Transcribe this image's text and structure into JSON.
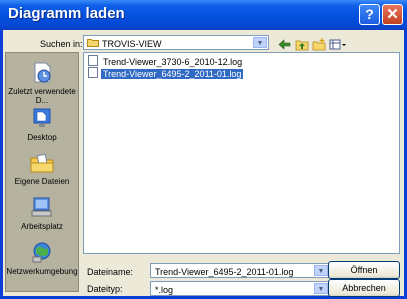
{
  "dialog": {
    "title": "Diagramm laden"
  },
  "titlebar": {
    "help_glyph": "?",
    "close_glyph": "✕"
  },
  "lookin": {
    "label": "Suchen in:",
    "value": "TROVIS-VIEW"
  },
  "toolbar": {
    "icons": [
      "back-arrow-icon",
      "up-folder-icon",
      "new-folder-icon",
      "view-menu-icon"
    ]
  },
  "places": [
    {
      "label": "Zuletzt verwendete D...",
      "icon": "recent-documents-icon"
    },
    {
      "label": "Desktop",
      "icon": "desktop-icon"
    },
    {
      "label": "Eigene Dateien",
      "icon": "my-documents-icon"
    },
    {
      "label": "Arbeitsplatz",
      "icon": "my-computer-icon"
    },
    {
      "label": "Netzwerkumgebung",
      "icon": "network-icon"
    }
  ],
  "files": [
    {
      "name": "Trend-Viewer_3730-6_2010-12.log",
      "selected": false
    },
    {
      "name": "Trend-Viewer_6495-2_2011-01.log",
      "selected": true
    }
  ],
  "filename": {
    "label": "Dateiname:",
    "value": "Trend-Viewer_6495-2_2011-01.log"
  },
  "filetype": {
    "label": "Dateityp:",
    "value": "*.log"
  },
  "buttons": {
    "open": "Öffnen",
    "cancel": "Abbrechen"
  },
  "colors": {
    "titlebar": "#0551e0",
    "selection": "#316ac5",
    "face": "#ece9d8"
  }
}
